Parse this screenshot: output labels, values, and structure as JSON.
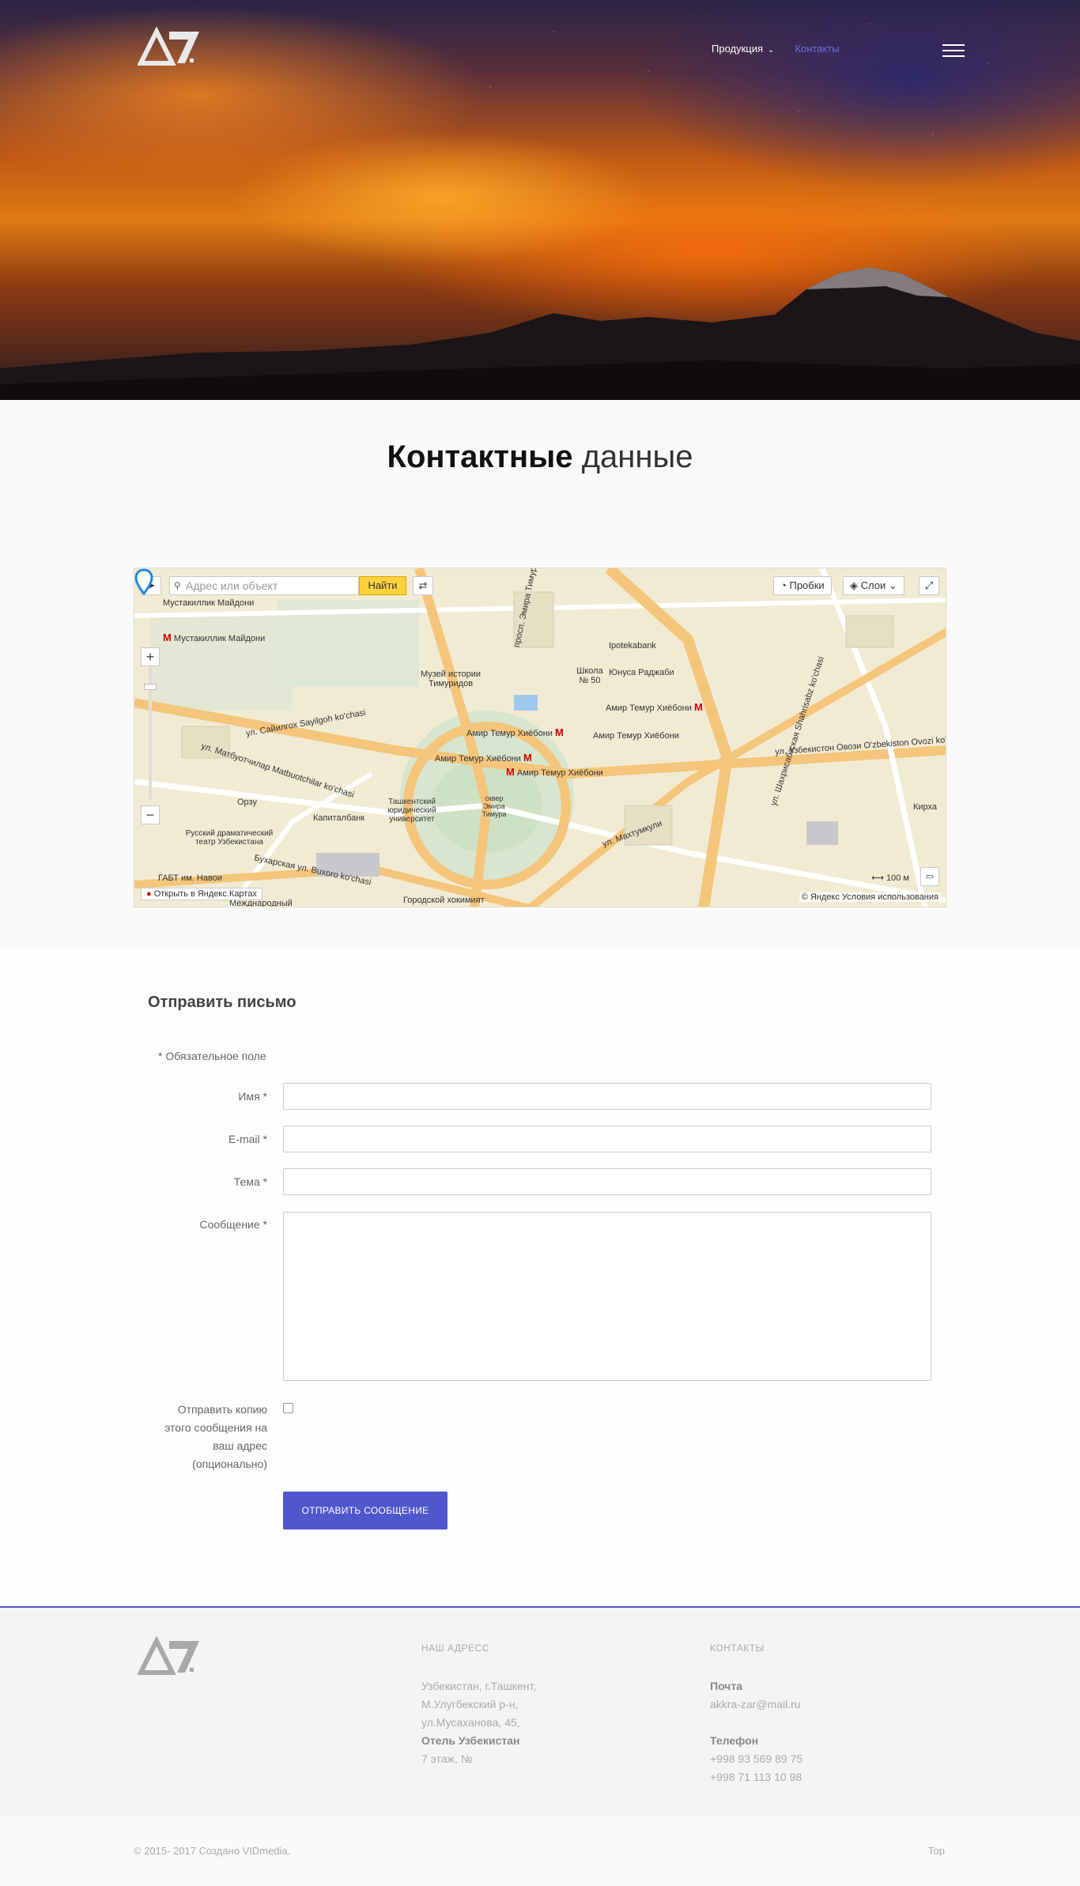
{
  "nav": {
    "items": [
      {
        "label": "Продукция"
      },
      {
        "label": "Контакты"
      }
    ]
  },
  "page_title": {
    "bold": "Контактные",
    "light": "данные"
  },
  "map": {
    "search_placeholder": "Адрес или объект",
    "find_label": "Найти",
    "traffic_label": "Пробки",
    "layers_label": "Слои",
    "copyright": "© Яндекс  Условия использования",
    "open_link": "Открыть в Яндекс.Картах",
    "scale": "100 м",
    "labels": [
      "Мустакиллик Майдони",
      "Музей истории Тимуридов",
      "Школа № 50",
      "Ipotekabank",
      "Юнуса Раджаби",
      "Амир Темур Хиёбони",
      "Амир Темур Хиёбони",
      "Амир Темур Хиёбони",
      "Амир Темур Хиёбони",
      "Амир Темур Хиёбони",
      "ул. Сайилгох Sayilgoh ko'chasi",
      "ул. Матбуотчилар Matbuotchilar ko'chasi",
      "Капиталбанк",
      "Ташкентский юридический университет",
      "Русский драматический театр Узбекистана",
      "ГАБТ им. Навои",
      "Бухарская ул. Buxoro ko'chasi",
      "ул. Махтумкули",
      "ул. Узбекистон Овози O'zbekiston Ovozi ko'chasi",
      "Городской хокимият",
      "Межднародный",
      "сквер Эмира Тимура",
      "просп. Эмира Тимура",
      "ул. Шахрисабзская Shahrisabz ko'chasi",
      "Орзу",
      "Кирха"
    ]
  },
  "form": {
    "title": "Отправить письмо",
    "required_note": "* Обязательное поле",
    "name_label": "Имя *",
    "email_label": "E-mail *",
    "subject_label": "Тема *",
    "message_label": "Сообщение *",
    "copy_label": [
      "Отправить копию",
      "этого сообщения на",
      "ваш адрес",
      "(опционально)"
    ],
    "submit_label": "ОТПРАВИТЬ СООБЩЕНИЕ"
  },
  "footer": {
    "address_heading": "НАШ АДРЕСС",
    "address_lines": [
      "Узбекистан, г.Ташкент,",
      "М.Улугбекский р-н,",
      "ул.Мусаханова, 45,"
    ],
    "hotel": "Отель Узбекистан",
    "floor": "7 этаж, №",
    "contacts_heading": "КОНТАКТЫ",
    "mail_label": "Почта",
    "mail": "akkra-zar@mail.ru",
    "phone_label": "Телефон",
    "phones": [
      "+998 93 569 89 75",
      "+998 71 113 10 98"
    ],
    "copyright": "© 2015- 2017 Создано VIDmedia.",
    "top_link": "Top"
  },
  "colors": {
    "accent": "#4f57cd",
    "nav_active": "#6b6fdd"
  }
}
